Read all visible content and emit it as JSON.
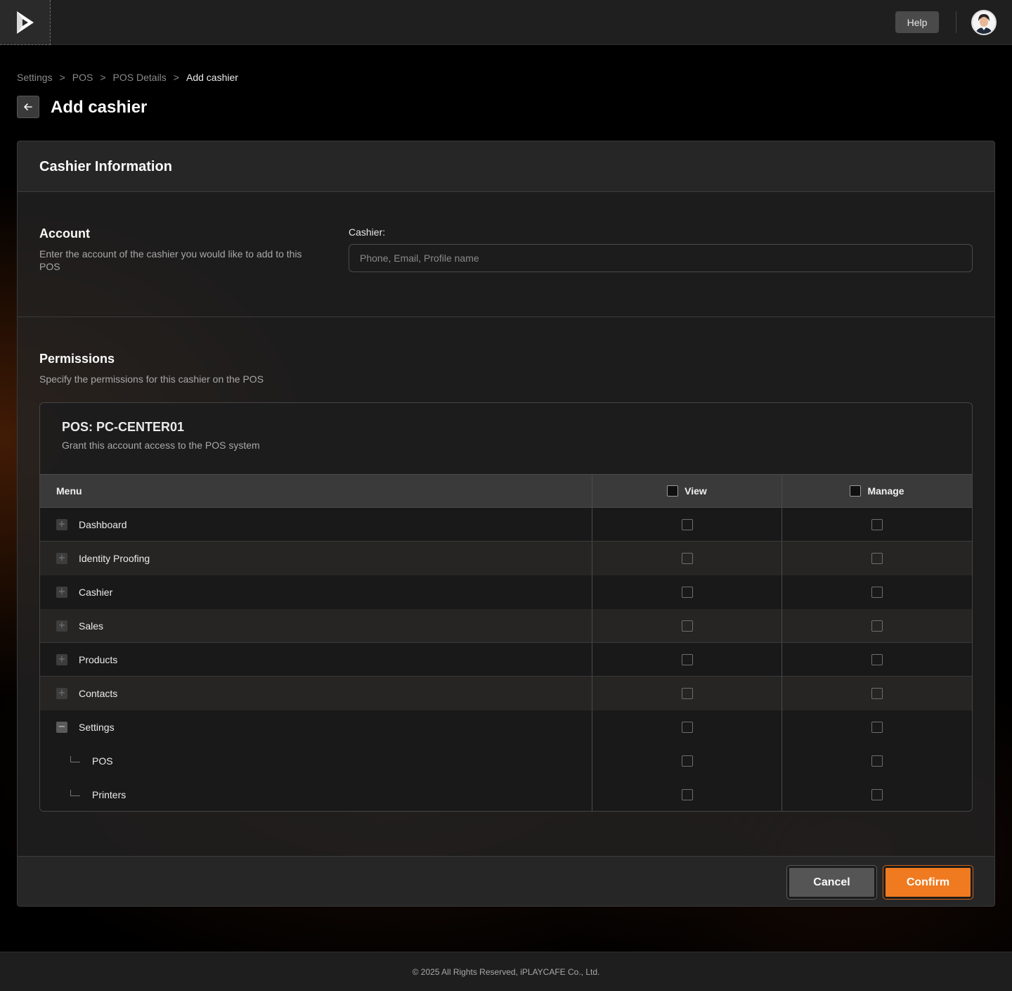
{
  "topbar": {
    "help_label": "Help"
  },
  "breadcrumb": {
    "items": [
      "Settings",
      "POS",
      "POS Details",
      "Add cashier"
    ],
    "separator": ">"
  },
  "page": {
    "title": "Add cashier"
  },
  "card": {
    "title": "Cashier Information"
  },
  "account": {
    "title": "Account",
    "description": "Enter the account of the cashier you would like to add to this POS",
    "field_label": "Cashier:",
    "placeholder": "Phone, Email, Profile name",
    "value": ""
  },
  "permissions": {
    "title": "Permissions",
    "description": "Specify the permissions for this cashier on the POS",
    "pos_title": "POS: PC-CENTER01",
    "pos_description": "Grant this account access to the POS system",
    "columns": {
      "menu": "Menu",
      "view": "View",
      "manage": "Manage"
    },
    "rows": [
      {
        "label": "Dashboard",
        "expander": "+",
        "view": false,
        "manage": false
      },
      {
        "label": "Identity Proofing",
        "expander": "+",
        "view": false,
        "manage": false
      },
      {
        "label": "Cashier",
        "expander": "+",
        "view": false,
        "manage": false
      },
      {
        "label": "Sales",
        "expander": "+",
        "view": false,
        "manage": false
      },
      {
        "label": "Products",
        "expander": "+",
        "view": false,
        "manage": false
      },
      {
        "label": "Contacts",
        "expander": "+",
        "view": false,
        "manage": false
      },
      {
        "label": "Settings",
        "expander": "−",
        "view": false,
        "manage": false
      },
      {
        "label": "POS",
        "child": true,
        "view": false,
        "manage": false
      },
      {
        "label": "Printers",
        "child": true,
        "view": false,
        "manage": false
      }
    ]
  },
  "actions": {
    "cancel_label": "Cancel",
    "confirm_label": "Confirm"
  },
  "footer": {
    "copyright": "© 2025 All Rights Reserved, iPLAYCAFE Co., Ltd."
  },
  "colors": {
    "accent": "#f07a1f",
    "background": "#000000",
    "surface": "#242424"
  }
}
